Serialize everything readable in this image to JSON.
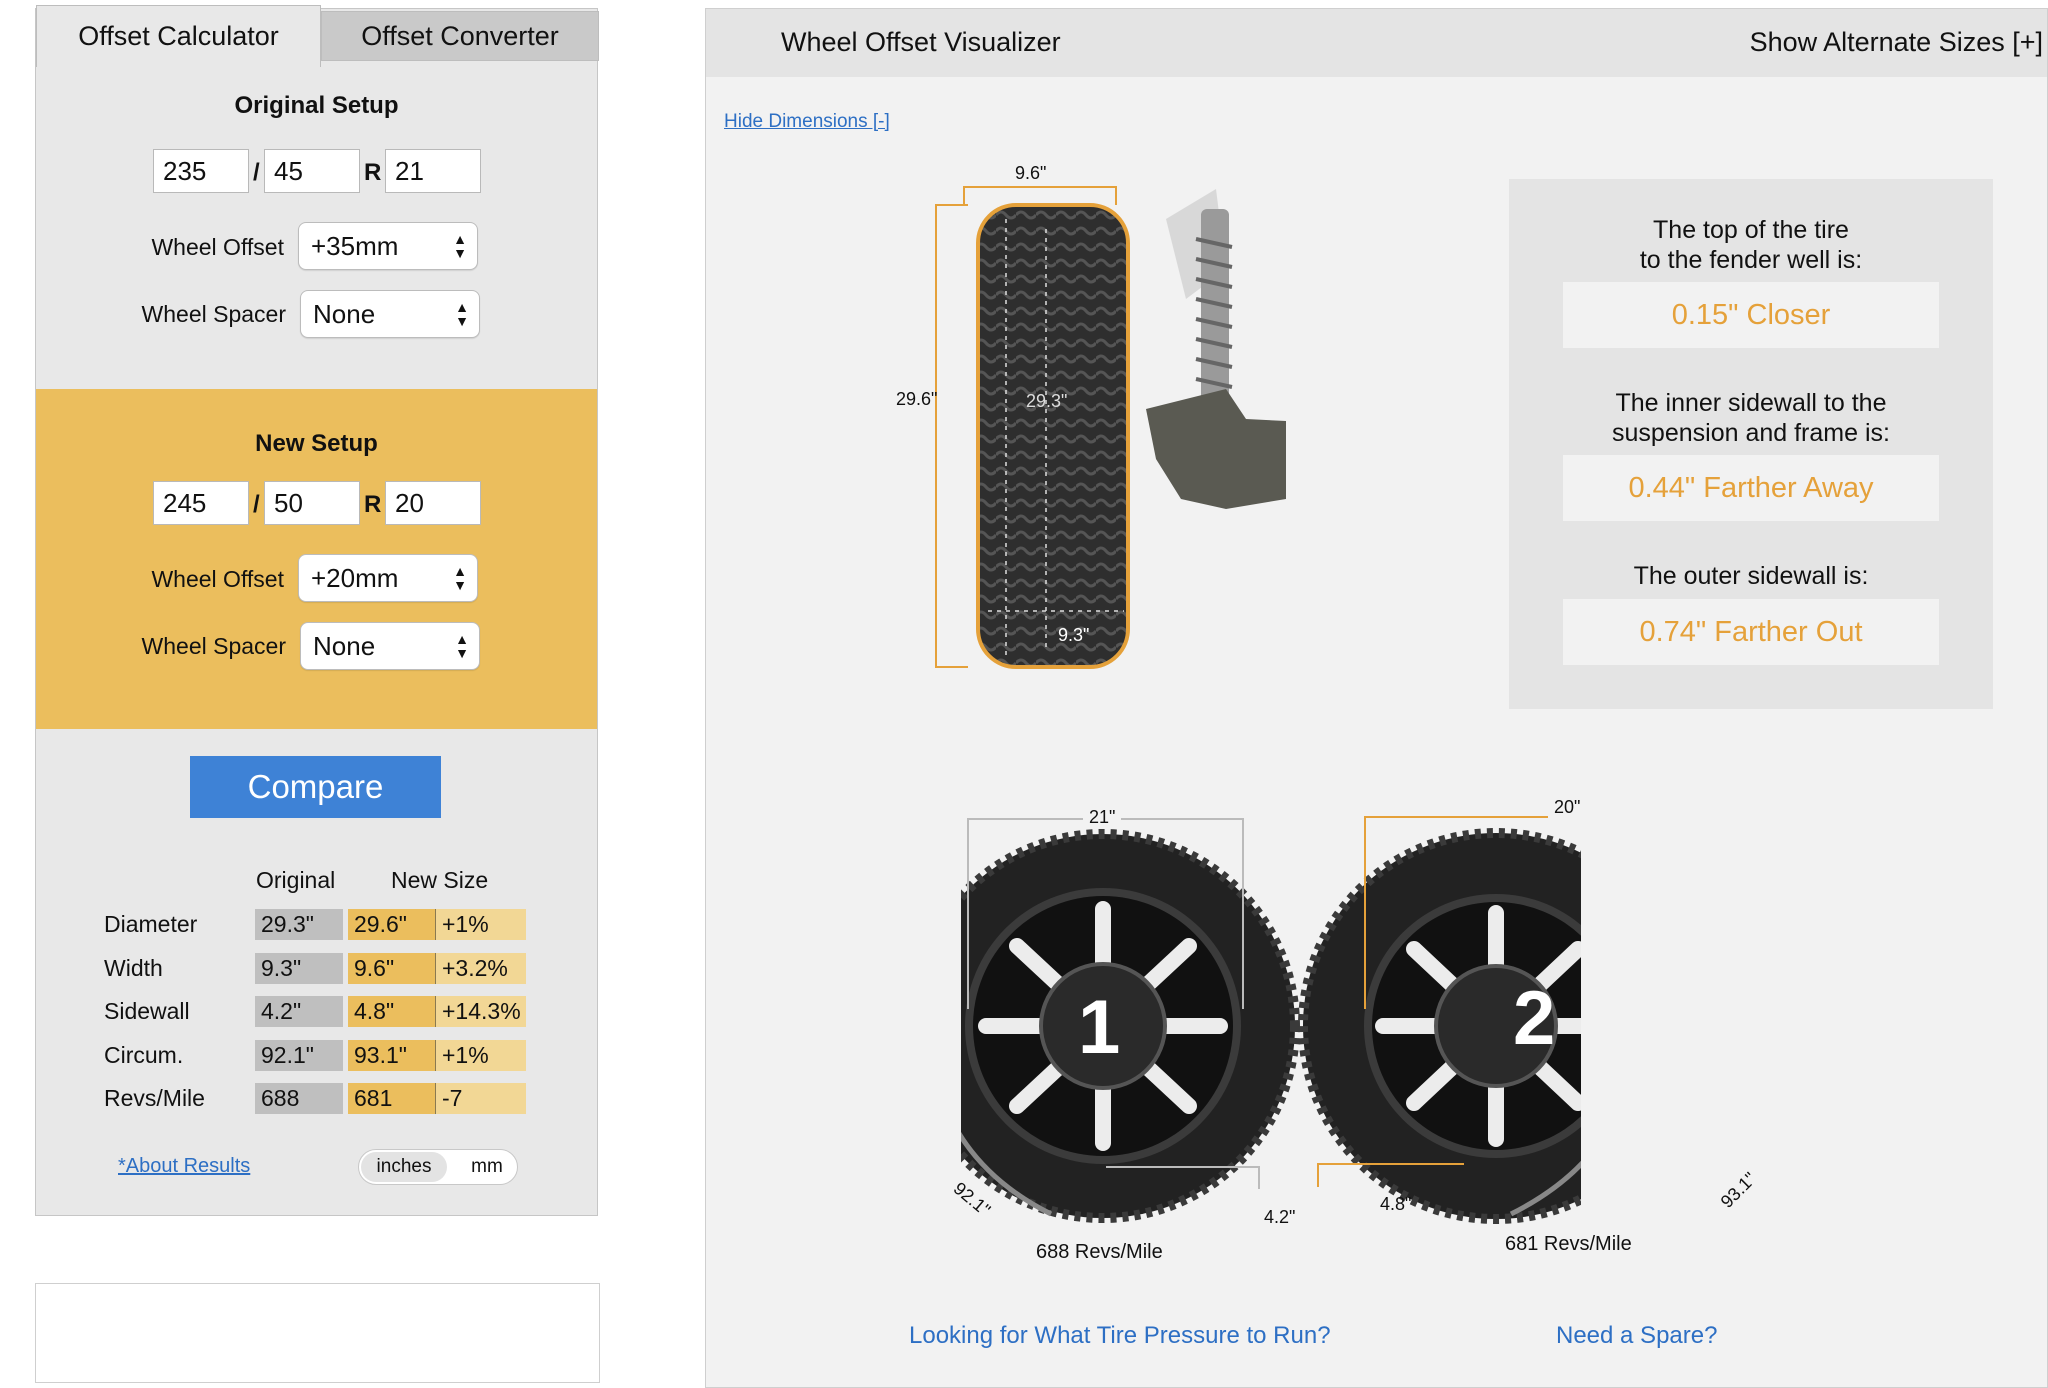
{
  "tabs": {
    "calculator": "Offset Calculator",
    "converter": "Offset Converter"
  },
  "original": {
    "title": "Original Setup",
    "width": "235",
    "aspect": "45",
    "rim": "21",
    "offset_label": "Wheel Offset",
    "offset": "+35mm",
    "spacer_label": "Wheel Spacer",
    "spacer": "None"
  },
  "new_setup": {
    "title": "New Setup",
    "width": "245",
    "aspect": "50",
    "rim": "20",
    "offset_label": "Wheel Offset",
    "offset": "+20mm",
    "spacer_label": "Wheel Spacer",
    "spacer": "None"
  },
  "separators": {
    "slash": "/",
    "r": "R"
  },
  "compare_button": "Compare",
  "results": {
    "col_original": "Original",
    "col_new": "New Size",
    "rows": [
      {
        "label": "Diameter",
        "original": "29.3\"",
        "new": "29.6\"",
        "diff": "+1%"
      },
      {
        "label": "Width",
        "original": "9.3\"",
        "new": "9.6\"",
        "diff": "+3.2%"
      },
      {
        "label": "Sidewall",
        "original": "4.2\"",
        "new": "4.8\"",
        "diff": "+14.3%"
      },
      {
        "label": "Circum.",
        "original": "92.1\"",
        "new": "93.1\"",
        "diff": "+1%"
      },
      {
        "label": "Revs/Mile",
        "original": "688",
        "new": "681",
        "diff": "-7"
      }
    ]
  },
  "about_link": "*About Results",
  "units": {
    "inches": "inches",
    "mm": "mm",
    "selected": "inches"
  },
  "visualizer": {
    "title": "Wheel Offset Visualizer",
    "alternate": "Show Alternate Sizes [+]",
    "hide_dimensions": "Hide Dimensions [-]",
    "side_dims": {
      "new_width": "9.6\"",
      "new_diameter": "29.6\"",
      "orig_diameter": "29.3\"",
      "orig_width": "9.3\""
    },
    "info": [
      {
        "text_line1": "The top of the tire",
        "text_line2": "to the fender well is:",
        "value": "0.15\" Closer"
      },
      {
        "text_line1": "The inner sidewall to the",
        "text_line2": "suspension and frame is:",
        "value": "0.44\" Farther Away"
      },
      {
        "text_line1": "The outer sidewall is:",
        "text_line2": "",
        "value": "0.74\" Farther Out"
      }
    ],
    "wheel1": {
      "number": "1",
      "rim": "21\"",
      "circ": "92.1\"",
      "sidewall": "4.2\"",
      "revs": "688 Revs/Mile"
    },
    "wheel2": {
      "number": "2",
      "rim": "20\"",
      "circ": "93.1\"",
      "sidewall": "4.8\"",
      "revs": "681 Revs/Mile"
    },
    "accent_color": "#e5a13a",
    "links": {
      "pressure": "Looking for What Tire Pressure to Run?",
      "spare": "Need a Spare?"
    }
  }
}
